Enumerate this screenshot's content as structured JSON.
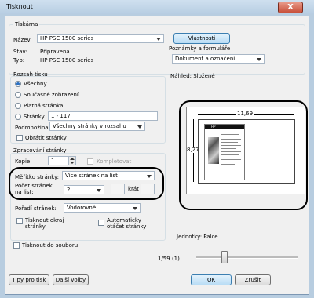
{
  "window": {
    "title": "Tisknout",
    "close_glyph": "X"
  },
  "printer": {
    "group_label": "Tiskárna",
    "name_label": "Název:",
    "name_value": "HP PSC 1500 series",
    "properties_button": "Vlastnosti",
    "status_label": "Stav:",
    "status_value": "Připravena",
    "type_label": "Typ:",
    "type_value": "HP PSC 1500 series",
    "paper_label": "Poznámky a formuláře",
    "paper_value": "Dokument a označení"
  },
  "range": {
    "group_label": "Rozsah tisku",
    "options": [
      "Všechny",
      "Současné zobrazení",
      "Platná stránka",
      "Stránky"
    ],
    "selected_index": 0,
    "pages_value": "1 - 117",
    "subset_label": "Podmnožina:",
    "subset_value": "Všechny stránky v rozsahu",
    "reverse_label": "Obrátit stránky"
  },
  "handling": {
    "group_label": "Zpracování stránky",
    "copies_label": "Kopie:",
    "copies_value": "1",
    "collate_label": "Kompletovat",
    "scaling_label": "Měřítko stránky:",
    "scaling_value": "Více stránek na list",
    "pps_label": "Počet stránek na list:",
    "pps_value": "2",
    "pps_by_label": "krát",
    "order_label": "Pořadí stránek:",
    "order_value": "Vodorovně",
    "border_label": "Tisknout okraj stránky",
    "autorotate_label": "Automaticky otáčet stránky"
  },
  "print_to_file_label": "Tisknout do souboru",
  "preview": {
    "label": "Náhled: Složené",
    "width_value": "11,69",
    "height_value": "8,27",
    "thumb_title": "HP",
    "units_label": "Jednotky: Palce",
    "page_counter": "1/59 (1)"
  },
  "footer": {
    "tips_button": "Tipy pro tisk",
    "advanced_button": "Další volby",
    "ok_button": "OK",
    "cancel_button": "Zrušit"
  },
  "colors": {
    "accent": "#2a6fc2",
    "highlight_border": "#000000"
  }
}
